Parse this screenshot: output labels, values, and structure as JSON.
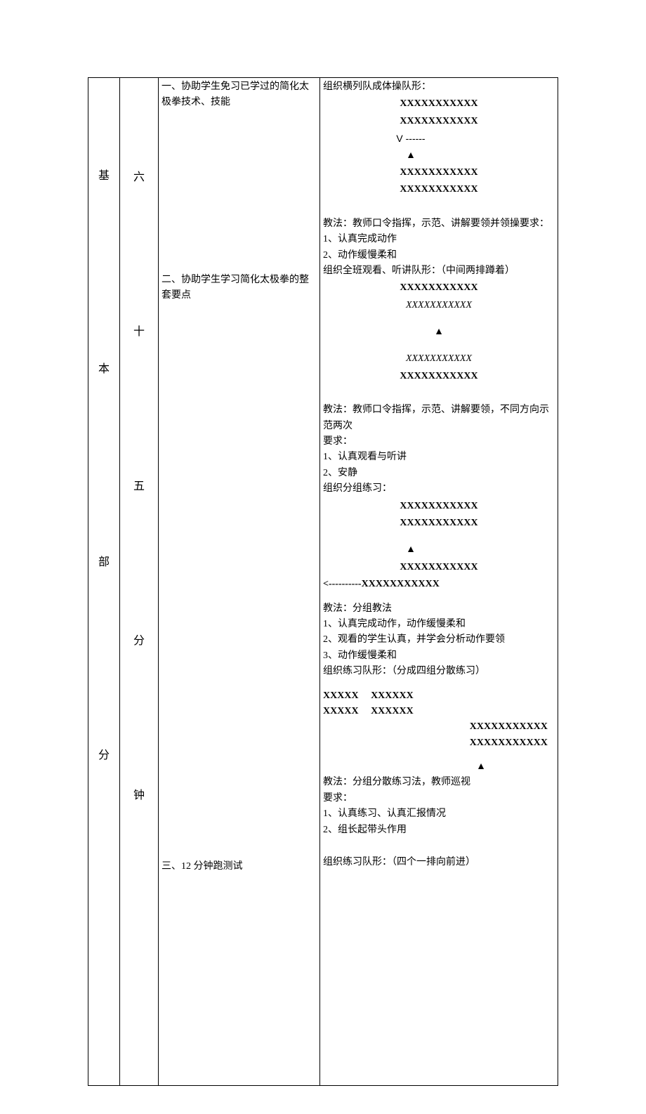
{
  "col1": {
    "chars": [
      "基",
      "本",
      "部",
      "分"
    ]
  },
  "col2": {
    "chars": [
      "六",
      "十",
      "五",
      "分",
      "钟"
    ]
  },
  "content_left": {
    "item1": "一、协助学生免习已学过的简化太极拳技术、技能",
    "item2": "二、协助学生学习简化太极拳的整套要点",
    "item3": "三、12 分钟跑测试"
  },
  "sec1": {
    "title": "组织横列队成体操队形：",
    "f1": "XXXXXXXXXXX",
    "f2": "XXXXXXXXXXX",
    "f3": "V ------",
    "f4": "▲",
    "f5": "XXXXXXXXXXX",
    "f6": "XXXXXXXXXXX",
    "method": "教法：教师口令指挥，示范、讲解要领并领操要求：",
    "r1": "1、认真完成动作",
    "r2": "2、动作缓慢柔和"
  },
  "sec2": {
    "title": "组织全班观看、听讲队形：（中间两排蹲着）",
    "f1": "XXXXXXXXXXX",
    "f2": "XXXXXXXXXXX",
    "f3": "▲",
    "f4": "XXXXXXXXXXX",
    "f5": "XXXXXXXXXXX",
    "method": "教法：教师口令指挥，示范、讲解要领，不同方向示范两次",
    "rhead": "要求：",
    "r1": "1、认真观看与听讲",
    "r2": "2、安静"
  },
  "sec3": {
    "title": "组织分组练习：",
    "f1": "XXXXXXXXXXX",
    "f2": "XXXXXXXXXXX",
    "f3": "▲",
    "f4": "XXXXXXXXXXX",
    "f5": "<----------XXXXXXXXXXX",
    "method": "教法：分组教法",
    "r1": "1、认真完成动作，动作缓慢柔和",
    "r2": "2、观看的学生认真，并学会分析动作要领",
    "r3": "3、动作缓慢柔和"
  },
  "sec4": {
    "title": "组织练习队形：（分成四组分散练习）",
    "g1a": "XXXXX",
    "g1b": "XXXXXX",
    "g2a": "XXXXX",
    "g2b": "XXXXXX",
    "fr1": "XXXXXXXXXXX",
    "fr2": "XXXXXXXXXXX",
    "f3": "▲",
    "method": "教法：分组分散练习法，教师巡视",
    "rhead": "要求：",
    "r1": "1、认真练习、认真汇报情况",
    "r2": "2、组长起带头作用"
  },
  "sec5": {
    "title": "组织练习队形：（四个一排向前进）"
  }
}
